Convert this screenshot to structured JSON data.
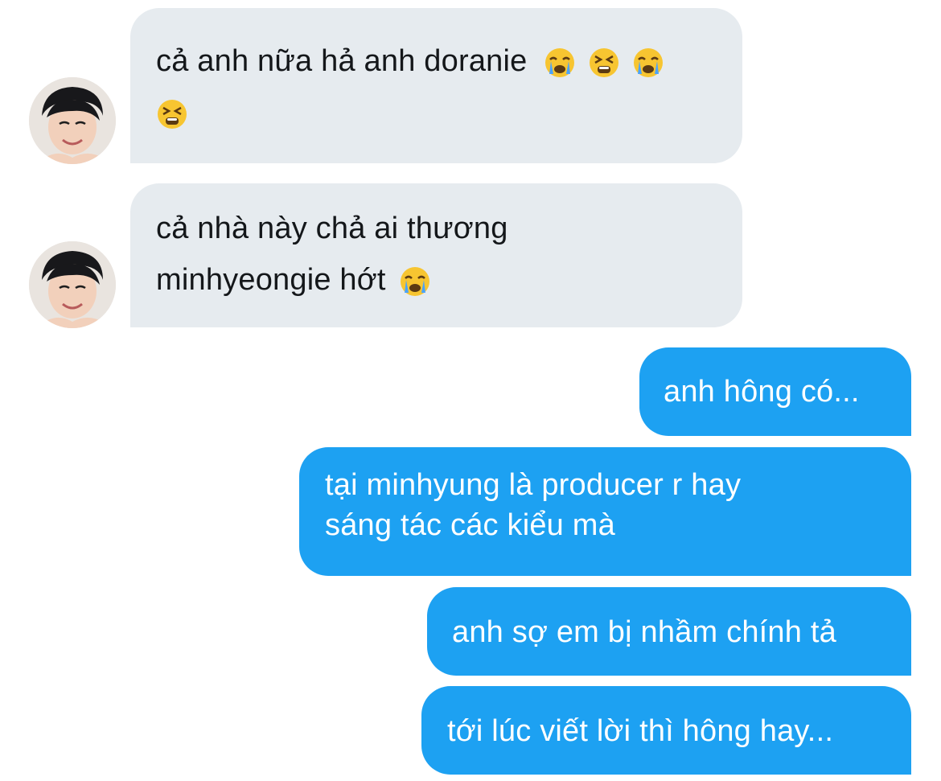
{
  "conversation": {
    "messages": [
      {
        "side": "incoming",
        "lines": [
          "cả anh nữa hả anh doranie",
          ""
        ]
      },
      {
        "side": "incoming",
        "lines": [
          "cả nhà này chả ai thương",
          "minhyeongie hớt"
        ]
      },
      {
        "side": "outgoing",
        "lines": [
          "anh hông có..."
        ]
      },
      {
        "side": "outgoing",
        "lines": [
          "tại minhyung là producer r hay",
          "sáng tác các kiểu mà"
        ]
      },
      {
        "side": "outgoing",
        "lines": [
          "anh sợ em bị nhầm chính tả"
        ]
      },
      {
        "side": "outgoing",
        "lines": [
          "tới lúc viết lời thì hông hay..."
        ]
      }
    ],
    "emoji_names": [
      "loudly-crying-face",
      "tired-face"
    ]
  },
  "colors": {
    "incoming_bubble": "#e6ebef",
    "outgoing_bubble": "#1da1f2",
    "incoming_text": "#14171a",
    "outgoing_text": "#ffffff"
  }
}
